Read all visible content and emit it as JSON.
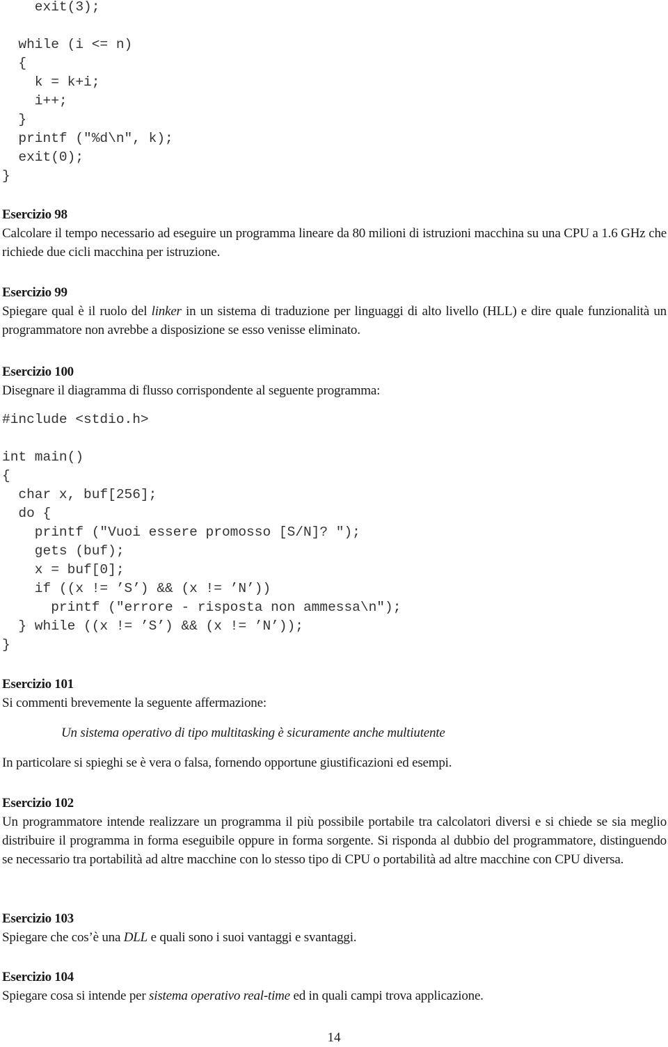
{
  "code_top": {
    "lines": [
      "    exit(3);",
      "",
      "  while (i <= n)",
      "  {",
      "    k = k+i;",
      "    i++;",
      "  }",
      "  printf (\"%d\\n\", k);",
      "  exit(0);",
      "}"
    ]
  },
  "exercises": [
    {
      "title": "Esercizio 98",
      "text": "Calcolare il tempo necessario ad eseguire un programma lineare da 80 milioni di istruzioni macchina su una CPU a 1.6 GHz che richiede due cicli macchina per istruzione."
    },
    {
      "title": "Esercizio 99",
      "text_before": "Spiegare qual è il ruolo del ",
      "text_italic": "linker",
      "text_after": " in un sistema di traduzione per linguaggi di alto livello (HLL) e dire quale funzionalità un programmatore non avrebbe a disposizione se esso venisse eliminato."
    },
    {
      "title": "Esercizio 100",
      "text": "Disegnare il diagramma di flusso corrispondente al seguente programma:",
      "code": [
        "#include <stdio.h>",
        "",
        "int main()",
        "{",
        "  char x, buf[256];",
        "  do {",
        "    printf (\"Vuoi essere promosso [S/N]? \");",
        "    gets (buf);",
        "    x = buf[0];",
        "    if ((x != ’S’) && (x != ’N’))",
        "      printf (\"errore - risposta non ammessa\\n\");",
        "  } while ((x != ’S’) && (x != ’N’));",
        "}"
      ]
    },
    {
      "title": "Esercizio 101",
      "text": "Si commenti brevemente la seguente affermazione:",
      "quote": "Un sistema operativo di tipo multitasking è sicuramente anche multiutente",
      "text2": "In particolare si spieghi se è vera o falsa, fornendo opportune giustificazioni ed esempi."
    },
    {
      "title": "Esercizio 102",
      "text": "Un programmatore intende realizzare un programma il più possibile portabile tra calcolatori diversi e si chiede se sia meglio distribuire il programma in forma eseguibile oppure in forma sorgente.  Si risponda al dubbio del programmatore, distinguendo se necessario tra portabilità ad altre macchine con lo stesso tipo di CPU o portabilità ad altre macchine con CPU diversa."
    },
    {
      "title": "Esercizio 103",
      "text_before": "Spiegare che cos’è una ",
      "text_italic": "DLL",
      "text_after": " e quali sono i suoi vantaggi e svantaggi."
    },
    {
      "title": "Esercizio 104",
      "text_before": "Spiegare cosa si intende per ",
      "text_italic": "sistema operativo real-time",
      "text_after": " ed in quali campi trova applicazione."
    }
  ],
  "page_number": "14"
}
